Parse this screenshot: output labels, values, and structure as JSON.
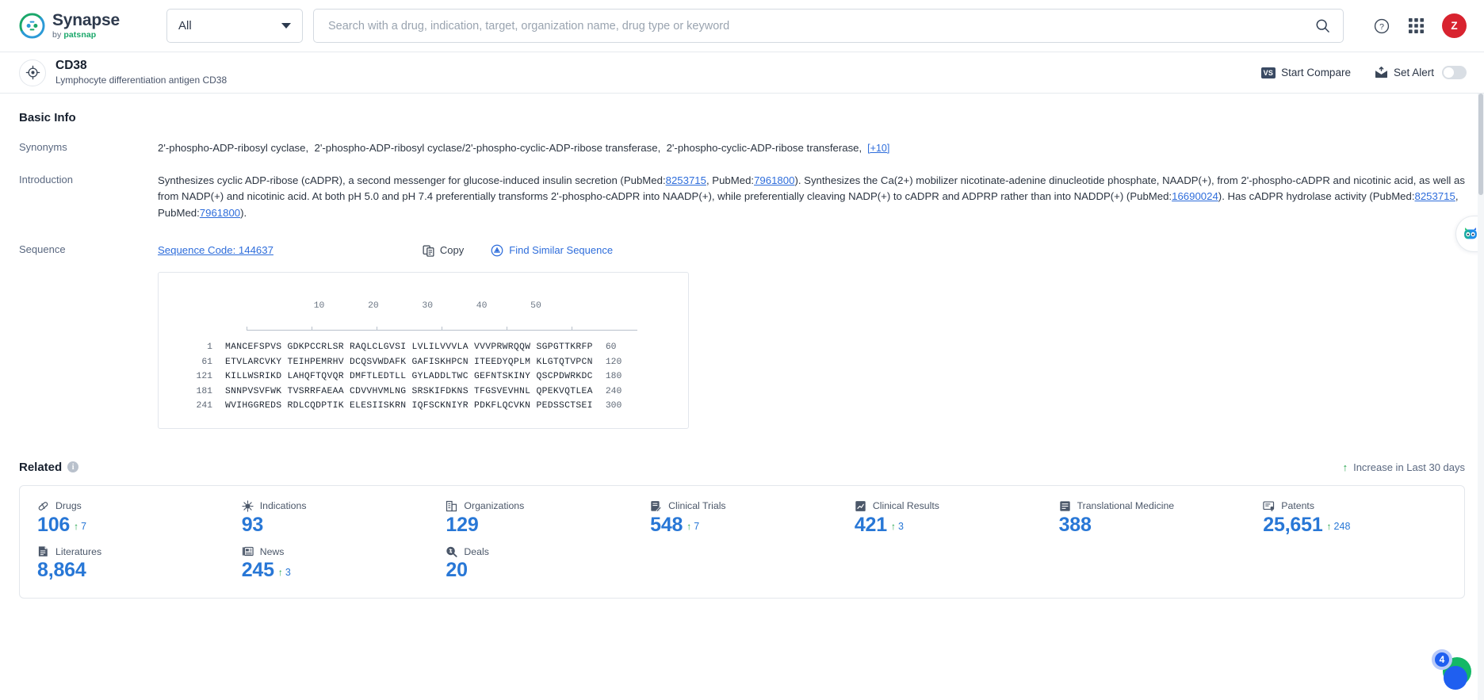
{
  "header": {
    "logo_name": "Synapse",
    "logo_by": "by",
    "logo_brand": "patsnap",
    "scope_value": "All",
    "search_placeholder": "Search with a drug, indication, target, organization name, drug type or keyword",
    "search_value": "",
    "help_icon": "help-circle-icon",
    "apps_icon": "grid-apps-icon",
    "avatar_initial": "Z"
  },
  "entity": {
    "icon": "target-icon",
    "title": "CD38",
    "subtitle": "Lymphocyte differentiation antigen CD38",
    "compare_badge": "VS",
    "compare_label": "Start Compare",
    "alert_label": "Set Alert",
    "alert_enabled": false
  },
  "basic_info": {
    "section_title": "Basic Info",
    "synonyms_label": "Synonyms",
    "synonyms": [
      "2'-phospho-ADP-ribosyl cyclase",
      "2'-phospho-ADP-ribosyl cyclase/2'-phospho-cyclic-ADP-ribose transferase",
      "2'-phospho-cyclic-ADP-ribose transferase"
    ],
    "synonyms_more": "[+10]",
    "introduction_label": "Introduction",
    "introduction_parts": [
      {
        "t": "Synthesizes cyclic ADP-ribose (cADPR), a second messenger for glucose-induced insulin secretion (PubMed:"
      },
      {
        "t": "8253715",
        "link": true
      },
      {
        "t": ", PubMed:"
      },
      {
        "t": "7961800",
        "link": true
      },
      {
        "t": "). Synthesizes the Ca(2+) mobilizer nicotinate-adenine dinucleotide phosphate, NAADP(+), from 2'-phospho-cADPR and nicotinic acid, as well as from NADP(+) and nicotinic acid. At both pH 5.0 and pH 7.4 preferentially transforms 2'-phospho-cADPR into NAADP(+), while preferentially cleaving NADP(+) to cADPR and ADPRP rather than into NADDP(+) (PubMed:"
      },
      {
        "t": "16690024",
        "link": true
      },
      {
        "t": "). Has cADPR hydrolase activity (PubMed:"
      },
      {
        "t": "8253715",
        "link": true
      },
      {
        "t": ", PubMed:"
      },
      {
        "t": "7961800",
        "link": true
      },
      {
        "t": ")."
      }
    ]
  },
  "sequence": {
    "label": "Sequence",
    "code_label": "Sequence Code: 144637",
    "copy_label": "Copy",
    "copy_icon": "copy-icon",
    "find_label": "Find Similar Sequence",
    "find_icon": "find-similar-icon",
    "ruler": [
      "10",
      "20",
      "30",
      "40",
      "50"
    ],
    "rows": [
      {
        "start": "1",
        "blocks": "MANCEFSPVS GDKPCCRLSR RAQLCLGVSI LVLILVVVLA VVVPRWRQQW SGPGTTKRFP",
        "end": "60"
      },
      {
        "start": "61",
        "blocks": "ETVLARCVKY TEIHPEMRHV DCQSVWDAFK GAFISKHPCN ITEEDYQPLM KLGTQTVPCN",
        "end": "120"
      },
      {
        "start": "121",
        "blocks": "KILLWSRIKD LAHQFTQVQR DMFTLEDTLL GYLADDLTWC GEFNTSKINY QSCPDWRKDC",
        "end": "180"
      },
      {
        "start": "181",
        "blocks": "SNNPVSVFWK TVSRRFAEAA CDVVHVMLNG SRSKIFDKNS TFGSVEVHNL QPEKVQTLEA",
        "end": "240"
      },
      {
        "start": "241",
        "blocks": "WVIHGGREDS RDLCQDPTIK ELESIISKRN IQFSCKNIYR PDKFLQCVKN PEDSSCTSEI",
        "end": "300"
      }
    ]
  },
  "related": {
    "title": "Related",
    "info_icon": "info-icon",
    "increase_label": "Increase in Last 30 days",
    "increase_arrow": "↑",
    "stats": [
      {
        "label": "Drugs",
        "icon": "capsule-icon",
        "value": "106",
        "delta": "7"
      },
      {
        "label": "Indications",
        "icon": "virus-icon",
        "value": "93",
        "delta": ""
      },
      {
        "label": "Organizations",
        "icon": "building-icon",
        "value": "129",
        "delta": ""
      },
      {
        "label": "Clinical Trials",
        "icon": "trial-flask-icon",
        "value": "548",
        "delta": "7"
      },
      {
        "label": "Clinical Results",
        "icon": "results-icon",
        "value": "421",
        "delta": "3"
      },
      {
        "label": "Translational Medicine",
        "icon": "translational-icon",
        "value": "388",
        "delta": ""
      },
      {
        "label": "Patents",
        "icon": "patent-icon",
        "value": "25,651",
        "delta": "248"
      },
      {
        "label": "Literatures",
        "icon": "literature-icon",
        "value": "8,864",
        "delta": ""
      },
      {
        "label": "News",
        "icon": "news-icon",
        "value": "245",
        "delta": "3"
      },
      {
        "label": "Deals",
        "icon": "deals-icon",
        "value": "20",
        "delta": ""
      }
    ]
  },
  "floating": {
    "assistant_icon": "ai-robot-icon",
    "fab_badge": "4",
    "fab_icon": "chat-bubble-icon"
  },
  "colors": {
    "accent_blue": "#2877d6",
    "link_blue": "#2e6ddb",
    "increase_green": "#22a44a",
    "avatar_red": "#d8232f",
    "brand_green": "#1aa76a"
  }
}
